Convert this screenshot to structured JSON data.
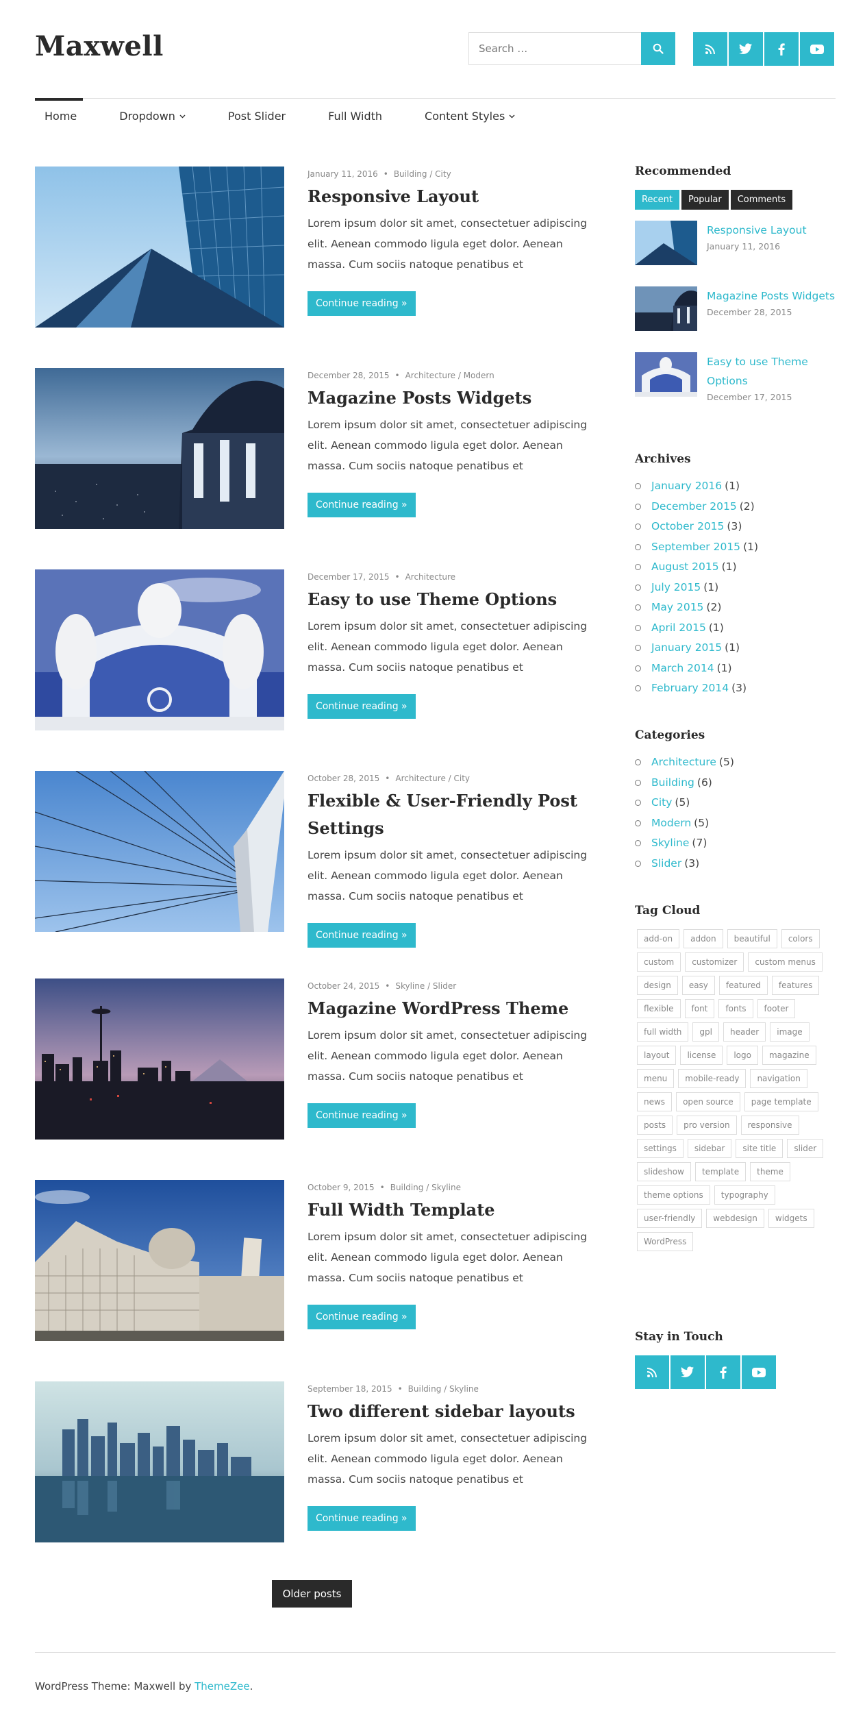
{
  "site": {
    "title": "Maxwell"
  },
  "search": {
    "placeholder": "Search …"
  },
  "colors": {
    "accent": "#2eb9cc",
    "dark": "#2a2a2a",
    "text": "#333333"
  },
  "social_icons": [
    "rss-icon",
    "twitter-icon",
    "facebook-icon",
    "youtube-icon"
  ],
  "nav": {
    "items": [
      {
        "label": "Home",
        "has_dropdown": false,
        "active": true
      },
      {
        "label": "Dropdown",
        "has_dropdown": true
      },
      {
        "label": "Post Slider",
        "has_dropdown": false
      },
      {
        "label": "Full Width",
        "has_dropdown": false
      },
      {
        "label": "Content Styles",
        "has_dropdown": true
      }
    ]
  },
  "posts": [
    {
      "date": "January 11, 2016",
      "categories": "Building / City",
      "title": "Responsive Layout",
      "excerpt": "Lorem ipsum dolor sit amet, consectetuer adipiscing elit. Aenean commodo ligula eget dolor. Aenean massa. Cum sociis natoque penatibus et",
      "read_more": "Continue reading »"
    },
    {
      "date": "December 28, 2015",
      "categories": "Architecture / Modern",
      "title": "Magazine Posts Widgets",
      "excerpt": "Lorem ipsum dolor sit amet, consectetuer adipiscing elit. Aenean commodo ligula eget dolor. Aenean massa. Cum sociis natoque penatibus et",
      "read_more": "Continue reading »"
    },
    {
      "date": "December 17, 2015",
      "categories": "Architecture",
      "title": "Easy to use Theme Options",
      "excerpt": "Lorem ipsum dolor sit amet, consectetuer adipiscing elit. Aenean commodo ligula eget dolor. Aenean massa. Cum sociis natoque penatibus et",
      "read_more": "Continue reading »"
    },
    {
      "date": "October 28, 2015",
      "categories": "Architecture / City",
      "title": "Flexible & User-Friendly Post Settings",
      "excerpt": "Lorem ipsum dolor sit amet, consectetuer adipiscing elit. Aenean commodo ligula eget dolor. Aenean massa. Cum sociis natoque penatibus et",
      "read_more": "Continue reading »"
    },
    {
      "date": "October 24, 2015",
      "categories": "Skyline / Slider",
      "title": "Magazine WordPress Theme",
      "excerpt": "Lorem ipsum dolor sit amet, consectetuer adipiscing elit. Aenean commodo ligula eget dolor. Aenean massa. Cum sociis natoque penatibus et",
      "read_more": "Continue reading »"
    },
    {
      "date": "October 9, 2015",
      "categories": "Building / Skyline",
      "title": "Full Width Template",
      "excerpt": "Lorem ipsum dolor sit amet, consectetuer adipiscing elit. Aenean commodo ligula eget dolor. Aenean massa. Cum sociis natoque penatibus et",
      "read_more": "Continue reading »"
    },
    {
      "date": "September 18, 2015",
      "categories": "Building / Skyline",
      "title": "Two different sidebar layouts",
      "excerpt": "Lorem ipsum dolor sit amet, consectetuer adipiscing elit. Aenean commodo ligula eget dolor. Aenean massa. Cum sociis natoque penatibus et",
      "read_more": "Continue reading »"
    }
  ],
  "pagination": {
    "older": "Older posts"
  },
  "sidebar": {
    "recommended": {
      "title": "Recommended",
      "tabs": [
        "Recent",
        "Popular",
        "Comments"
      ],
      "items": [
        {
          "title": "Responsive Layout",
          "date": "January 11, 2016"
        },
        {
          "title": "Magazine Posts Widgets",
          "date": "December 28, 2015"
        },
        {
          "title": "Easy to use Theme Options",
          "date": "December 17, 2015"
        }
      ]
    },
    "archives": {
      "title": "Archives",
      "items": [
        {
          "label": "January 2016",
          "count": "(1)"
        },
        {
          "label": "December 2015",
          "count": "(2)"
        },
        {
          "label": "October 2015",
          "count": "(3)"
        },
        {
          "label": "September 2015",
          "count": "(1)"
        },
        {
          "label": "August 2015",
          "count": "(1)"
        },
        {
          "label": "July 2015",
          "count": "(1)"
        },
        {
          "label": "May 2015",
          "count": "(2)"
        },
        {
          "label": "April 2015",
          "count": "(1)"
        },
        {
          "label": "January 2015",
          "count": "(1)"
        },
        {
          "label": "March 2014",
          "count": "(1)"
        },
        {
          "label": "February 2014",
          "count": "(3)"
        }
      ]
    },
    "categories": {
      "title": "Categories",
      "items": [
        {
          "label": "Architecture",
          "count": "(5)"
        },
        {
          "label": "Building",
          "count": "(6)"
        },
        {
          "label": "City",
          "count": "(5)"
        },
        {
          "label": "Modern",
          "count": "(5)"
        },
        {
          "label": "Skyline",
          "count": "(7)"
        },
        {
          "label": "Slider",
          "count": "(3)"
        }
      ]
    },
    "tag_cloud": {
      "title": "Tag Cloud",
      "tags": [
        "add-on",
        "addon",
        "beautiful",
        "colors",
        "custom",
        "customizer",
        "custom menus",
        "design",
        "easy",
        "featured",
        "features",
        "flexible",
        "font",
        "fonts",
        "footer",
        "full width",
        "gpl",
        "header",
        "image",
        "layout",
        "license",
        "logo",
        "magazine",
        "menu",
        "mobile-ready",
        "navigation",
        "news",
        "open source",
        "page template",
        "posts",
        "pro version",
        "responsive",
        "settings",
        "sidebar",
        "site title",
        "slider",
        "slideshow",
        "template",
        "theme",
        "theme options",
        "typography",
        "user-friendly",
        "webdesign",
        "widgets",
        "WordPress"
      ]
    },
    "stay_in_touch": {
      "title": "Stay in Touch"
    }
  },
  "footer": {
    "prefix": "WordPress Theme: Maxwell by ",
    "link": "ThemeZee",
    "suffix": "."
  }
}
